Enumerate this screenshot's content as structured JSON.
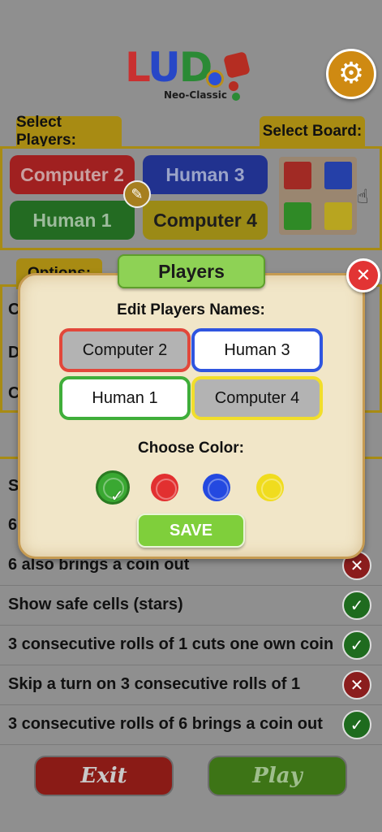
{
  "logo": {
    "letters": [
      "L",
      "U",
      "D"
    ],
    "subtitle": "Neo-Classic"
  },
  "icons": {
    "settings": "gear-icon",
    "edit": "pencil-icon",
    "close": "close-icon",
    "check": "check-icon",
    "cross": "cross-icon",
    "cursor": "hand-pointer-icon"
  },
  "select_players": {
    "label": "Select Players:",
    "buttons": [
      {
        "name": "Computer 2",
        "color": "#a02020"
      },
      {
        "name": "Human 3",
        "color": "#21328f"
      },
      {
        "name": "Human 1",
        "color": "#236b22"
      },
      {
        "name": "Computer 4",
        "color": "#9b8a16"
      }
    ]
  },
  "select_board": {
    "label": "Select Board:"
  },
  "options": {
    "label": "Options:",
    "row_initials": [
      "C",
      "D",
      "C"
    ],
    "rules_initials": [
      "S",
      "6"
    ]
  },
  "rules": [
    {
      "text": "6 also brings a coin out",
      "enabled": false
    },
    {
      "text": "Show safe cells (stars)",
      "enabled": true
    },
    {
      "text": "3 consecutive rolls of 1 cuts one own coin",
      "enabled": true
    },
    {
      "text": "Skip a turn on 3 consecutive rolls of 1",
      "enabled": false
    },
    {
      "text": "3 consecutive rolls of 6 brings a coin out",
      "enabled": true
    }
  ],
  "bottom": {
    "exit_label": "Exit",
    "play_label": "Play"
  },
  "dialog": {
    "title": "Players",
    "edit_heading": "Edit Players Names:",
    "names": [
      {
        "value": "Computer 2",
        "color": "#e2473a"
      },
      {
        "value": "Human 3",
        "color": "#2f55e0"
      },
      {
        "value": "Human 1",
        "color": "#3fae3a"
      },
      {
        "value": "Computer 4",
        "color": "#f1de2b"
      }
    ],
    "color_heading": "Choose Color:",
    "colors": [
      {
        "name": "green",
        "hex": "#3aa832",
        "selected": true
      },
      {
        "name": "red",
        "hex": "#e23030",
        "selected": false
      },
      {
        "name": "blue",
        "hex": "#2449e0",
        "selected": false
      },
      {
        "name": "yellow",
        "hex": "#f0dc1e",
        "selected": false
      }
    ],
    "save_label": "SAVE"
  }
}
